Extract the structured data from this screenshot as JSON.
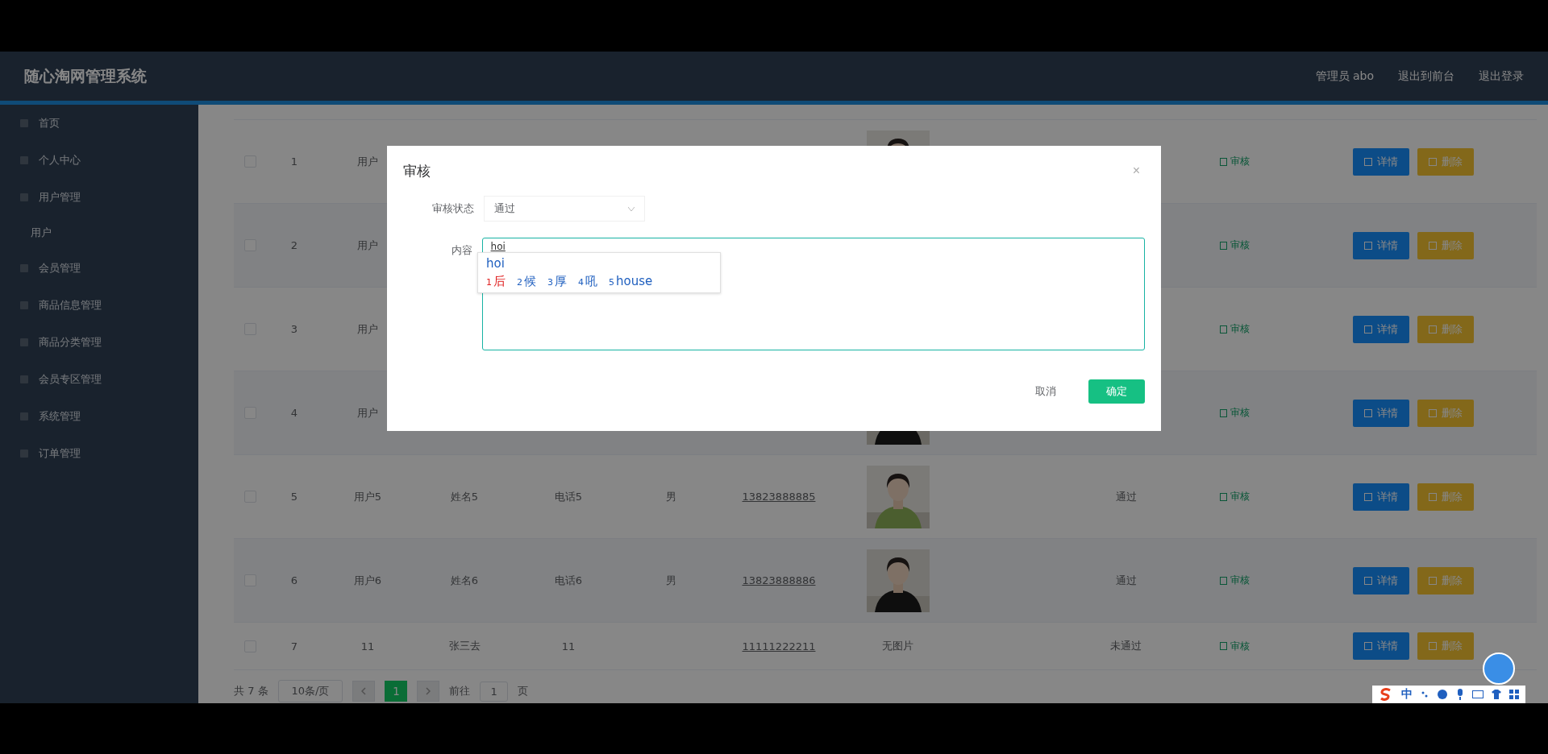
{
  "header": {
    "title": "随心淘网管理系统",
    "user": "管理员 abo",
    "links": [
      "退出到前台",
      "退出登录"
    ]
  },
  "sidebar": {
    "items": [
      {
        "label": "首页"
      },
      {
        "label": "个人中心"
      },
      {
        "label": "用户管理",
        "children": [
          {
            "label": "用户"
          }
        ]
      },
      {
        "label": "会员管理"
      },
      {
        "label": "商品信息管理"
      },
      {
        "label": "商品分类管理"
      },
      {
        "label": "会员专区管理"
      },
      {
        "label": "系统管理"
      },
      {
        "label": "订单管理"
      }
    ]
  },
  "table": {
    "rows": [
      {
        "checked": false,
        "index": "1",
        "username": "用户",
        "picture": true,
        "review": "审核",
        "actions": [
          "详情",
          "删除"
        ]
      },
      {
        "checked": false,
        "index": "2",
        "username": "用户",
        "review": "审核",
        "actions": [
          "详情",
          "删除"
        ]
      },
      {
        "checked": false,
        "index": "3",
        "username": "用户",
        "review": "审核",
        "actions": [
          "详情",
          "删除"
        ]
      },
      {
        "checked": false,
        "index": "4",
        "username": "用户",
        "picture": true,
        "review": "审核",
        "actions": [
          "详情",
          "删除"
        ]
      },
      {
        "checked": false,
        "index": "5",
        "username": "用户5",
        "name": "姓名5",
        "column_4": "电话5",
        "gender": "男",
        "phone": "13823888885",
        "picture": true,
        "status": "通过",
        "review": "审核",
        "actions": [
          "详情",
          "删除"
        ]
      },
      {
        "checked": false,
        "index": "6",
        "username": "用户6",
        "name": "姓名6",
        "column_4": "电话6",
        "gender": "男",
        "phone": "13823888886",
        "picture": true,
        "status": "通过",
        "review": "审核",
        "actions": [
          "详情",
          "删除"
        ]
      },
      {
        "kind": "text",
        "checked": false,
        "index": "7",
        "username": "11",
        "name": "张三去",
        "column_4": "11",
        "phone": "11111222211",
        "photo_text": "无图片",
        "status": "未通过",
        "review": "审核",
        "actions": [
          "详情",
          "删除"
        ]
      }
    ]
  },
  "pagination": {
    "total": "共 7 条",
    "page_size": "10条/页",
    "pages": [
      {
        "label": "1",
        "selected": true
      }
    ],
    "goto_label": "前往",
    "goto_value": "1",
    "goto_suffix": "页"
  },
  "dialog": {
    "title": "审核",
    "close": "×",
    "fields": [
      {
        "kind": "select",
        "label": "审核状态",
        "value": "通过"
      },
      {
        "kind": "textarea",
        "label": "内容",
        "value": "hoi"
      }
    ],
    "buttons": [
      {
        "label": "取消",
        "primary": false
      },
      {
        "label": "确定",
        "primary": true
      }
    ]
  },
  "ime": {
    "composition": "hoi",
    "candidates": [
      {
        "num": "1",
        "text": "后",
        "selected": true
      },
      {
        "num": "2",
        "text": "候",
        "selected": false
      },
      {
        "num": "3",
        "text": "厚",
        "selected": false
      },
      {
        "num": "4",
        "text": "吼",
        "selected": false
      },
      {
        "num": "5",
        "text": "house",
        "selected": false
      }
    ],
    "mode": "中"
  }
}
